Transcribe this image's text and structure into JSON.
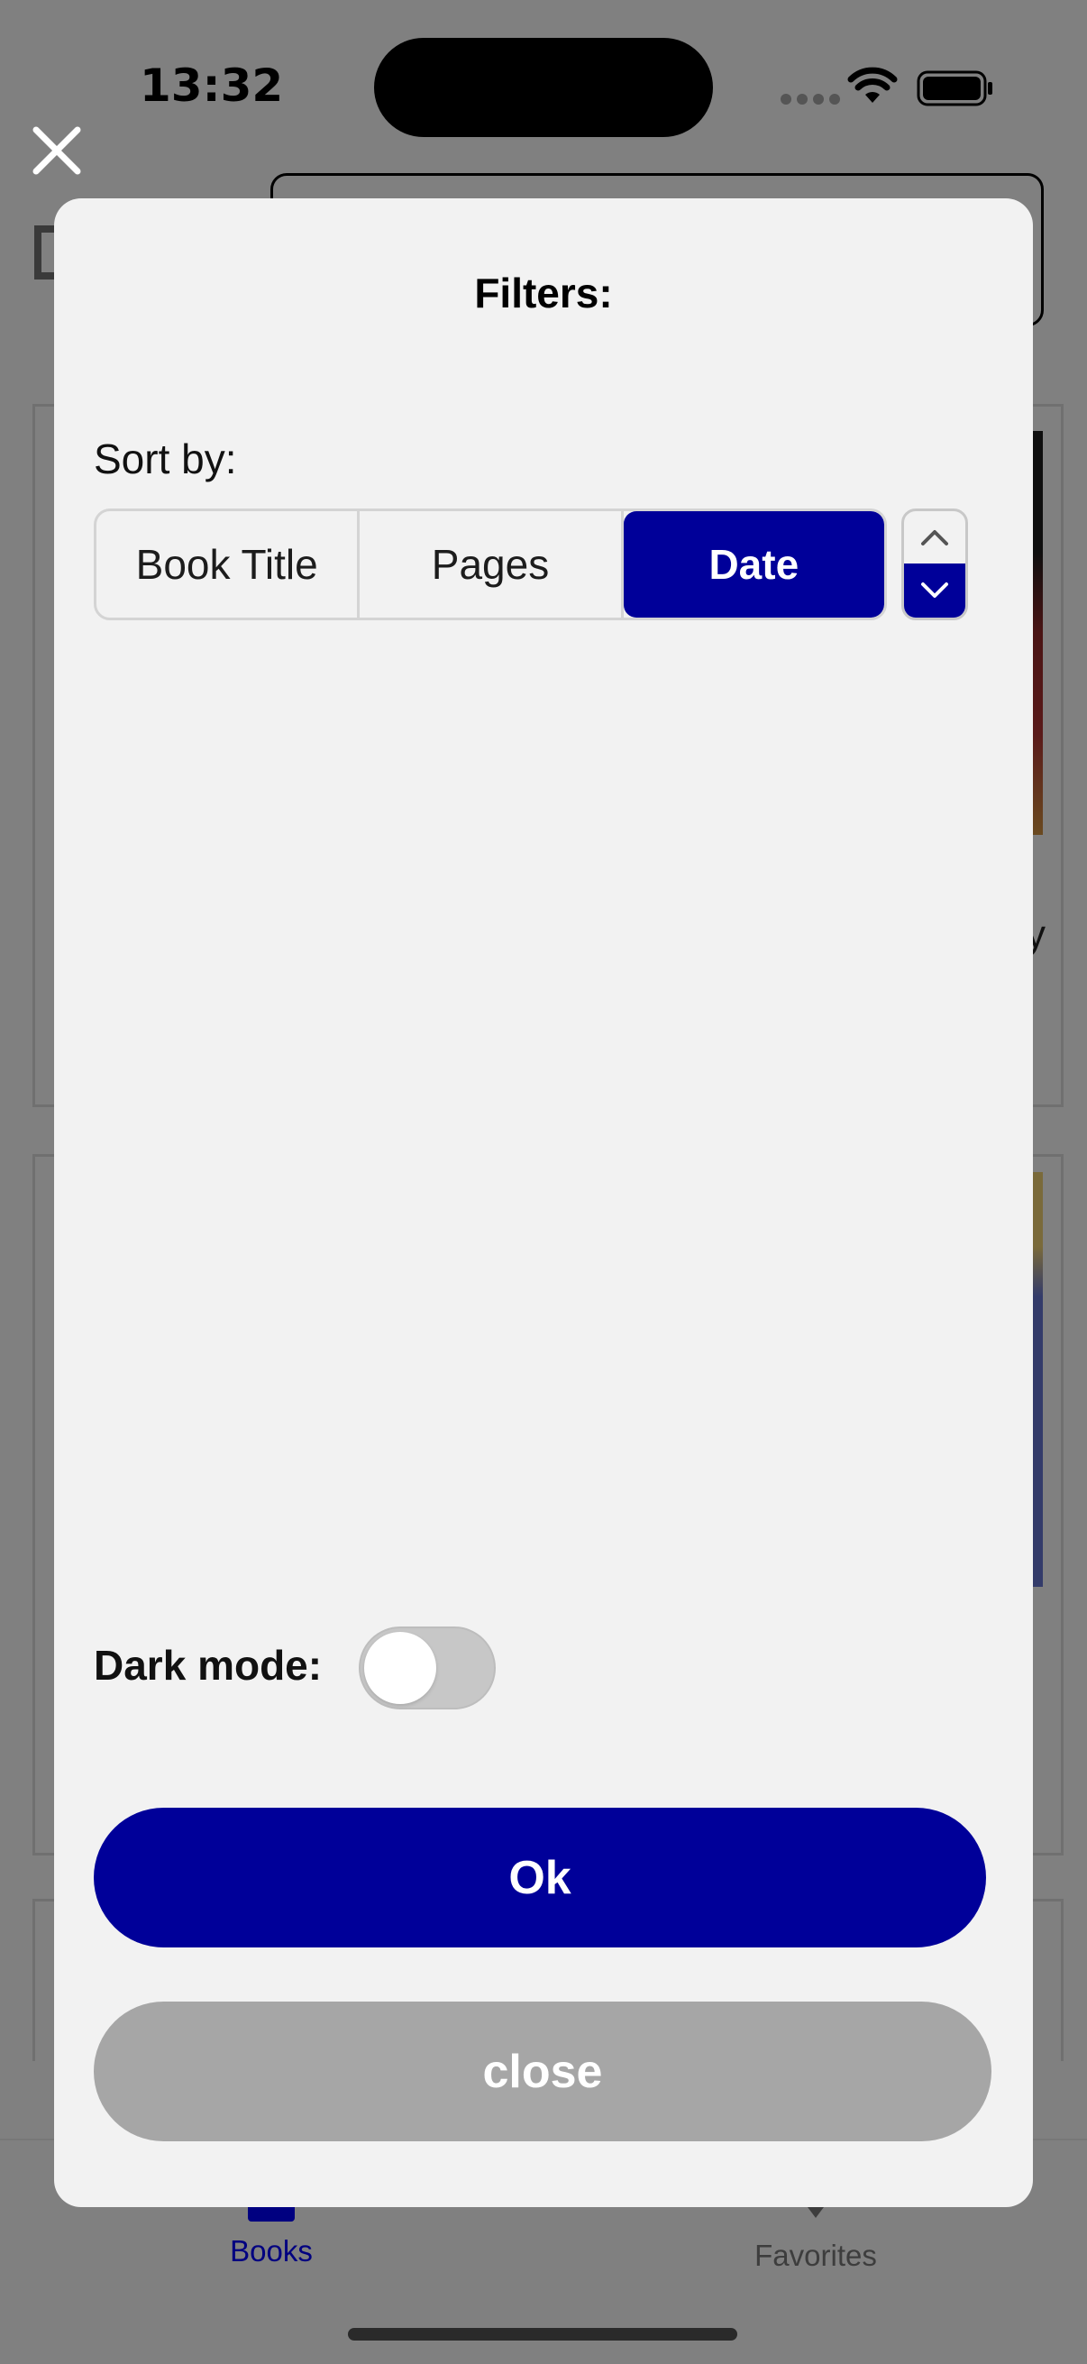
{
  "status_bar": {
    "time": "13:32"
  },
  "background_app": {
    "tabs": [
      {
        "label": "Books",
        "icon": "books-icon",
        "color": "#000080"
      },
      {
        "label": "Favorites",
        "icon": "heart-icon"
      }
    ],
    "partial_text": "y"
  },
  "modal": {
    "title": "Filters:",
    "sort_label": "Sort by:",
    "sort_options": [
      "Book Title",
      "Pages",
      "Date"
    ],
    "selected_sort": "Date",
    "sort_order": "descending",
    "dark_mode_label": "Dark mode:",
    "dark_mode_enabled": false,
    "ok_label": "Ok",
    "close_label": "close"
  },
  "colors": {
    "accent": "#000099",
    "overlay": "#808080",
    "modal_bg": "#f2f2f2",
    "close_button": "#a6a6a6"
  }
}
